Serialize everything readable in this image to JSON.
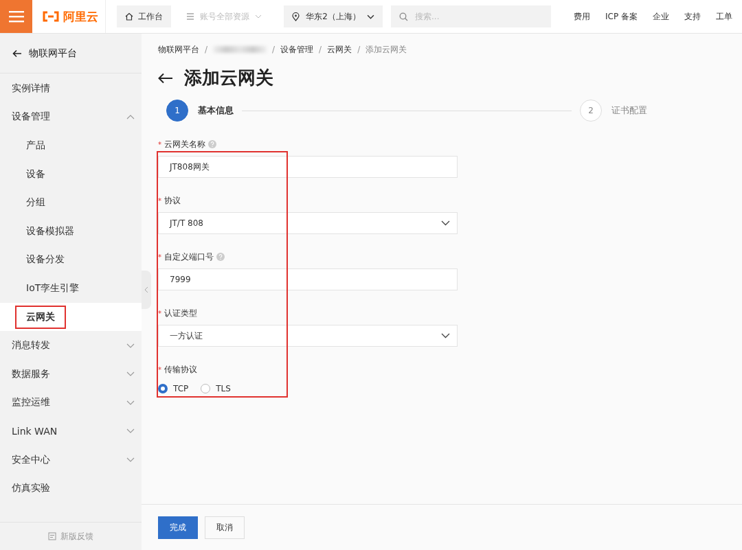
{
  "topbar": {
    "logo": "阿里云",
    "workbench": "工作台",
    "resources": "账号全部资源",
    "region": "华东2（上海）",
    "search_placeholder": "搜索...",
    "links": [
      "费用",
      "ICP 备案",
      "企业",
      "支持",
      "工单"
    ]
  },
  "sidebar": {
    "back": "物联网平台",
    "items": [
      {
        "label": "实例详情"
      },
      {
        "label": "设备管理",
        "expanded": true,
        "children": [
          {
            "label": "产品",
            "selected": false,
            "highlighted": false
          },
          {
            "label": "设备",
            "selected": false,
            "highlighted": false
          },
          {
            "label": "分组",
            "selected": false,
            "highlighted": false
          },
          {
            "label": "设备模拟器",
            "selected": false,
            "highlighted": false
          },
          {
            "label": "设备分发",
            "selected": false,
            "highlighted": false
          },
          {
            "label": "IoT孪生引擎",
            "selected": false,
            "highlighted": false
          },
          {
            "label": "云网关",
            "selected": true,
            "highlighted": true
          }
        ]
      },
      {
        "label": "消息转发",
        "expanded": false
      },
      {
        "label": "数据服务",
        "expanded": false
      },
      {
        "label": "监控运维",
        "expanded": false
      },
      {
        "label": "Link WAN",
        "expanded": false
      },
      {
        "label": "安全中心",
        "expanded": false
      },
      {
        "label": "仿真实验"
      }
    ],
    "feedback": "新版反馈"
  },
  "breadcrumb": [
    {
      "label": "物联网平台",
      "kind": "text"
    },
    {
      "label": "/",
      "kind": "separator"
    },
    {
      "kind": "blurred"
    },
    {
      "label": "/",
      "kind": "separator"
    },
    {
      "label": "设备管理",
      "kind": "text"
    },
    {
      "label": "/",
      "kind": "separator"
    },
    {
      "label": "云网关",
      "kind": "text"
    },
    {
      "label": "/",
      "kind": "separator"
    },
    {
      "label": "添加云网关",
      "kind": "current"
    }
  ],
  "title": "添加云网关",
  "steps": [
    {
      "number": "1",
      "label": "基本信息",
      "selected": true
    },
    {
      "number": "2",
      "label": "证书配置",
      "selected": false
    }
  ],
  "form": {
    "highlighted": true,
    "fields": [
      {
        "kind": "input",
        "label": "云网关名称",
        "required_mark": "*",
        "help": true,
        "value": "JT808网关"
      },
      {
        "kind": "select",
        "label": "协议",
        "required_mark": "*",
        "help": false,
        "value": "JT/T 808"
      },
      {
        "kind": "input",
        "label": "自定义端口号",
        "required_mark": "*",
        "help": true,
        "value": "7999"
      },
      {
        "kind": "select",
        "label": "认证类型",
        "required_mark": "*",
        "help": false,
        "value": "一方认证"
      },
      {
        "kind": "radio",
        "label": "传输协议",
        "required_mark": "*",
        "help": false,
        "options": [
          {
            "label": "TCP",
            "selected": true
          },
          {
            "label": "TLS",
            "selected": false
          }
        ]
      }
    ]
  },
  "buttons": [
    {
      "label": "完成",
      "kind": "primary"
    },
    {
      "label": "取消",
      "kind": "secondary"
    }
  ]
}
